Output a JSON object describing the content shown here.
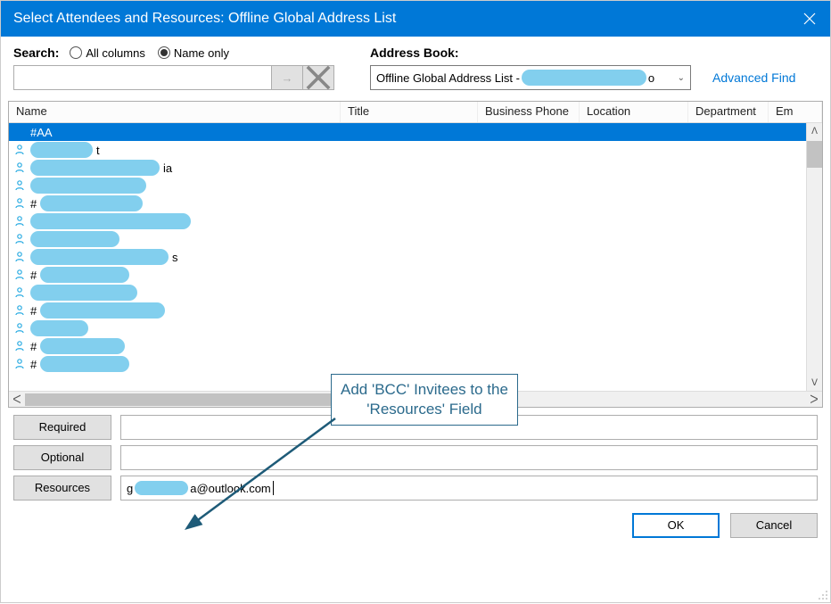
{
  "window": {
    "title": "Select Attendees and Resources: Offline Global Address List"
  },
  "search": {
    "label": "Search:",
    "option_all": "All columns",
    "option_name": "Name only",
    "value": ""
  },
  "addressbook": {
    "label": "Address Book:",
    "selected_prefix": "Offline Global Address List -",
    "selected_suffix": "o",
    "advanced_find": "Advanced Find"
  },
  "columns": {
    "name": "Name",
    "title": "Title",
    "phone": "Business Phone",
    "location": "Location",
    "department": "Department",
    "email": "Em"
  },
  "rows": [
    {
      "text": "#AA",
      "selected": true,
      "visible_suffix": "",
      "extra": ""
    },
    {
      "visible_suffix": "t",
      "extra": ""
    },
    {
      "visible_suffix": "ia",
      "extra": ""
    },
    {
      "visible_suffix": "",
      "extra": ""
    },
    {
      "visible_prefix": "#",
      "extra": ""
    },
    {
      "visible_suffix": "",
      "extra": ""
    },
    {
      "visible_suffix": "",
      "extra": ""
    },
    {
      "visible_suffix": "s",
      "extra": ""
    },
    {
      "visible_prefix": "#",
      "extra": ""
    },
    {
      "visible_suffix": "",
      "extra": ""
    },
    {
      "visible_prefix": "#",
      "extra": ""
    },
    {
      "visible_suffix": "",
      "extra": ""
    },
    {
      "visible_prefix": "#",
      "extra": ""
    },
    {
      "visible_prefix": "#",
      "extra": ""
    }
  ],
  "fields": {
    "required_label": "Required",
    "optional_label": "Optional",
    "resources_label": "Resources",
    "required_value": "",
    "optional_value": "",
    "resources_prefix": "g",
    "resources_suffix": "a@outlook.com"
  },
  "buttons": {
    "ok": "OK",
    "cancel": "Cancel"
  },
  "callout": {
    "line1": "Add 'BCC' Invitees to the",
    "line2": "'Resources' Field"
  }
}
